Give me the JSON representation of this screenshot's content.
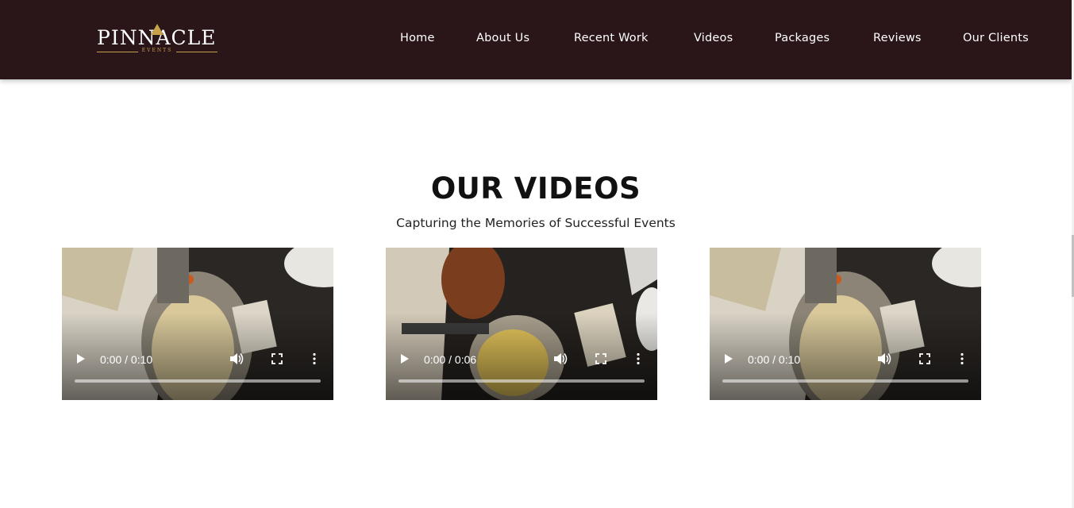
{
  "header": {
    "logo_text": "PINNACLE",
    "logo_sub": "EVENTS",
    "nav": [
      "Home",
      "About Us",
      "Recent Work",
      "Videos",
      "Packages",
      "Reviews",
      "Our Clients"
    ]
  },
  "section": {
    "title": "OUR VIDEOS",
    "subtitle": "Capturing the Memories of Successful Events"
  },
  "videos": [
    {
      "time": "0:00 / 0:10",
      "progress": 0
    },
    {
      "time": "0:00 / 0:06",
      "progress": 0
    },
    {
      "time": "0:00 / 0:10",
      "progress": 0
    }
  ],
  "colors": {
    "header_bg": "#2a1519",
    "logo_gold": "#c8a24a",
    "nav_text": "#ffffff"
  },
  "icons": [
    "play-icon",
    "volume-icon",
    "fullscreen-icon",
    "more-options-icon",
    "logo-triangle-icon"
  ]
}
